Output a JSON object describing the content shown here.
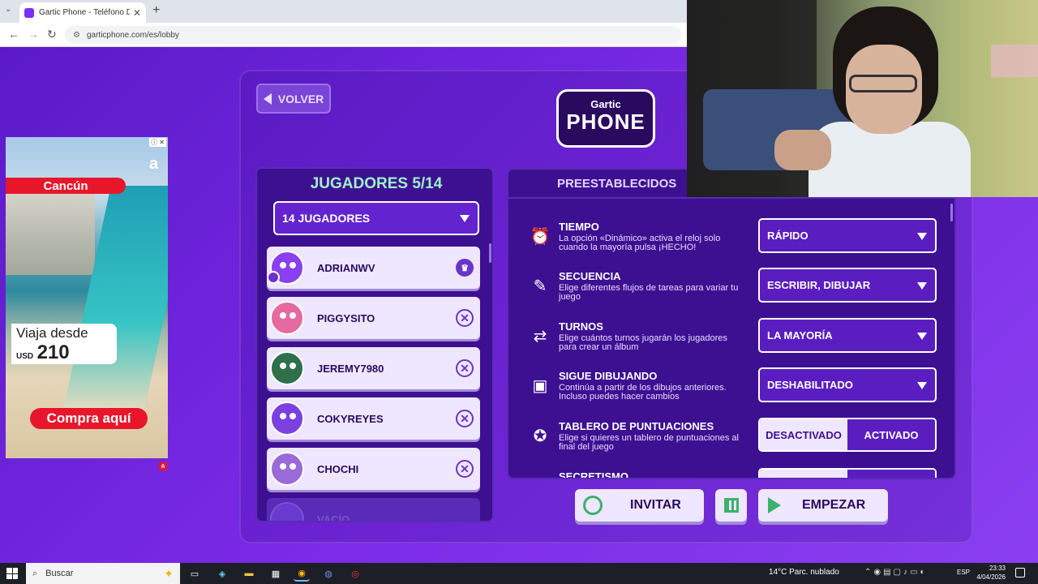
{
  "browser": {
    "tab_title": "Gartic Phone - Teléfono Descon",
    "url": "garticphone.com/es/lobby"
  },
  "ad": {
    "brand": "a",
    "destination": "Cancún",
    "price_prefix": "Viaja desde",
    "currency": "USD",
    "amount": "210",
    "cta": "Compra aquí",
    "badge": "A"
  },
  "header": {
    "back_label": "VOLVER",
    "logo_top": "Gartic",
    "logo_bottom": "PHONE"
  },
  "players": {
    "title": "JUGADORES 5/14",
    "count_select": "14 JUGADORES",
    "list": [
      {
        "name": "ADRIANWV",
        "role": "host",
        "color": "#8a3ff0"
      },
      {
        "name": "PIGGYSITO",
        "role": "guest",
        "color": "#e46aa0"
      },
      {
        "name": "JEREMY7980",
        "role": "guest",
        "color": "#2f6f4a"
      },
      {
        "name": "COKYREYES",
        "role": "guest",
        "color": "#7c3fe0"
      },
      {
        "name": "CHOCHI",
        "role": "guest",
        "color": "#9a6ad8"
      },
      {
        "name": "VACÍO",
        "role": "empty",
        "color": "#6a3ad0"
      }
    ]
  },
  "settings": {
    "tab_label": "PREESTABLECIDOS",
    "rows": [
      {
        "title": "TIEMPO",
        "desc": "La opción «Dinámico» activa el reloj solo cuando la mayoría pulsa ¡HECHO!",
        "value": "RÁPIDO",
        "icon": "alarm-icon"
      },
      {
        "title": "SECUENCIA",
        "desc": "Elige diferentes flujos de tareas para variar tu juego",
        "value": "ESCRIBIR, DIBUJAR",
        "icon": "brush-chat-icon"
      },
      {
        "title": "TURNOS",
        "desc": "Elige cuántos turnos jugarán los jugadores para crear un álbum",
        "value": "LA MAYORÍA",
        "icon": "turns-icon"
      },
      {
        "title": "SIGUE DIBUJANDO",
        "desc": "Continúa a partir de los dibujos anteriores. Incluso puedes hacer cambios",
        "value": "DESHABILITADO",
        "icon": "picture-icon"
      },
      {
        "title": "TABLERO DE PUNTUACIONES",
        "desc": "Elige si quieres un tablero de puntuaciones al final del juego",
        "toggle_off": "DESACTIVADO",
        "toggle_on": "ACTIVADO",
        "icon": "medal-icon"
      },
      {
        "title": "SECRETISMO",
        "desc": "",
        "icon": "secret-icon"
      }
    ]
  },
  "actions": {
    "invite": "INVITAR",
    "start": "EMPEZAR"
  },
  "taskbar": {
    "search": "Buscar",
    "weather": "14°C  Parc. nublado",
    "lang": "ESP",
    "time": "23:33",
    "date": "4/04/2026"
  }
}
